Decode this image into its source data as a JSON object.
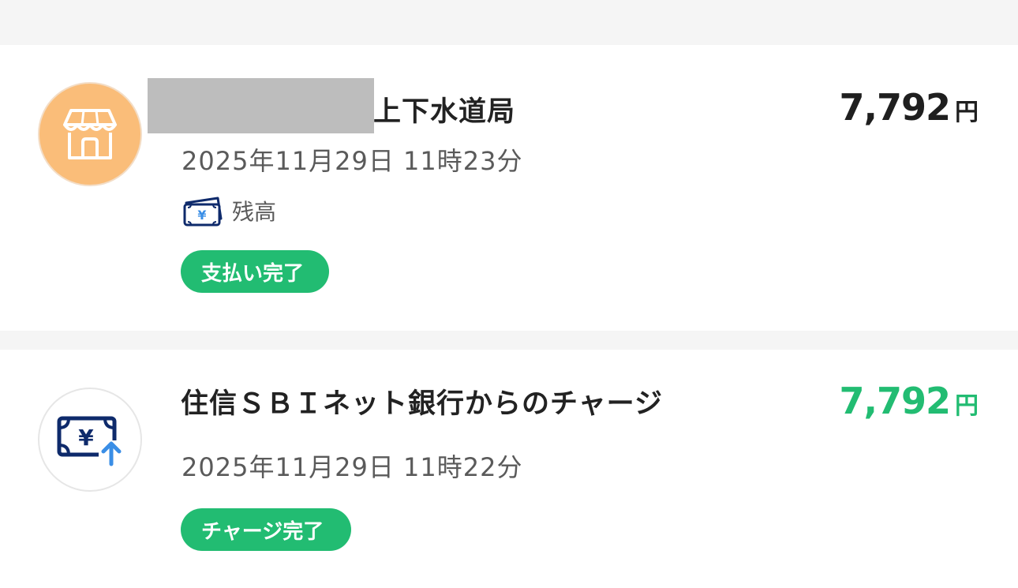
{
  "transactions": [
    {
      "title": "上下水道局",
      "amount": "7,792",
      "currency": "円",
      "datetime": "2025年11月29日 11時23分",
      "method": {
        "label": "残高",
        "icon": "yen-banknote-icon"
      },
      "status": "支払い完了",
      "icon": "store-icon",
      "amount_color": "#1f1f1f",
      "avatar_color": "#fabd79"
    },
    {
      "title": "住信ＳＢＩネット銀行からのチャージ",
      "amount": "7,792",
      "currency": "円",
      "datetime": "2025年11月29日 11時22分",
      "status": "チャージ完了",
      "icon": "yen-charge-icon",
      "amount_color": "#22bc72"
    }
  ],
  "colors": {
    "status_badge": "#22bc72",
    "background": "#f5f5f5"
  }
}
